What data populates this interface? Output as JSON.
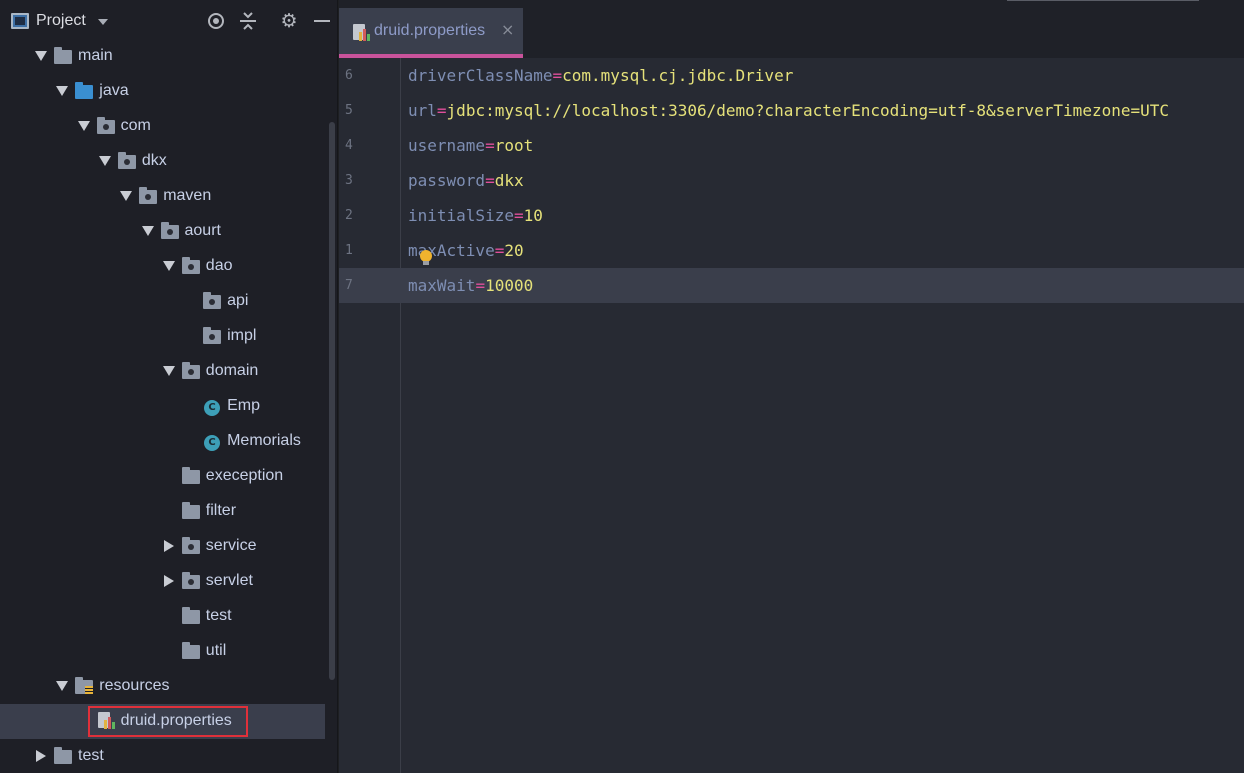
{
  "panel": {
    "title": "Project"
  },
  "tree": [
    {
      "label": "main",
      "depth": 0,
      "expanded": true,
      "icon": "folder"
    },
    {
      "label": "java",
      "depth": 1,
      "expanded": true,
      "icon": "source-folder"
    },
    {
      "label": "com",
      "depth": 2,
      "expanded": true,
      "icon": "package"
    },
    {
      "label": "dkx",
      "depth": 3,
      "expanded": true,
      "icon": "package"
    },
    {
      "label": "maven",
      "depth": 4,
      "expanded": true,
      "icon": "package"
    },
    {
      "label": "aourt",
      "depth": 5,
      "expanded": true,
      "icon": "package"
    },
    {
      "label": "dao",
      "depth": 6,
      "expanded": true,
      "icon": "package"
    },
    {
      "label": "api",
      "depth": 7,
      "icon": "package"
    },
    {
      "label": "impl",
      "depth": 7,
      "icon": "package"
    },
    {
      "label": "domain",
      "depth": 6,
      "expanded": true,
      "icon": "package"
    },
    {
      "label": "Emp",
      "depth": 7,
      "icon": "class"
    },
    {
      "label": "Memorials",
      "depth": 7,
      "icon": "class"
    },
    {
      "label": "exeception",
      "depth": 6,
      "icon": "folder"
    },
    {
      "label": "filter",
      "depth": 6,
      "icon": "folder"
    },
    {
      "label": "service",
      "depth": 6,
      "expanded": false,
      "icon": "package"
    },
    {
      "label": "servlet",
      "depth": 6,
      "expanded": false,
      "icon": "package"
    },
    {
      "label": "test",
      "depth": 6,
      "icon": "folder"
    },
    {
      "label": "util",
      "depth": 6,
      "icon": "folder"
    },
    {
      "label": "resources",
      "depth": 1,
      "expanded": true,
      "icon": "resources-folder"
    },
    {
      "label": "druid.properties",
      "depth": 2,
      "icon": "properties-file",
      "selected": true
    },
    {
      "label": "test",
      "depth": 0,
      "expanded": false,
      "icon": "folder"
    }
  ],
  "editor": {
    "tab": {
      "label": "druid.properties",
      "close": "×"
    },
    "lines": [
      {
        "no": "6",
        "key": "driverClassName",
        "eq": "=",
        "value": "com.mysql.cj.jdbc.Driver"
      },
      {
        "no": "5",
        "key": "url",
        "eq": "=",
        "value": "jdbc:mysql://localhost:3306/demo?characterEncoding=utf-8&serverTimezone=UTC"
      },
      {
        "no": "4",
        "key": "username",
        "eq": "=",
        "value": "root"
      },
      {
        "no": "3",
        "key": "password",
        "eq": "=",
        "value": "dkx"
      },
      {
        "no": "2",
        "key": "initialSize",
        "eq": "=",
        "value": "10"
      },
      {
        "no": "1",
        "key": "maxActive",
        "eq": "=",
        "value": "20"
      },
      {
        "no": "7",
        "key": "maxWait",
        "eq": "=",
        "value": "10000",
        "current": true
      }
    ]
  },
  "colors": {
    "key": "#7e8eb3",
    "equals": "#e04f9b",
    "value": "#e5e17a",
    "tab_underline": "#c9539b",
    "selection_outline": "#e0303a"
  }
}
